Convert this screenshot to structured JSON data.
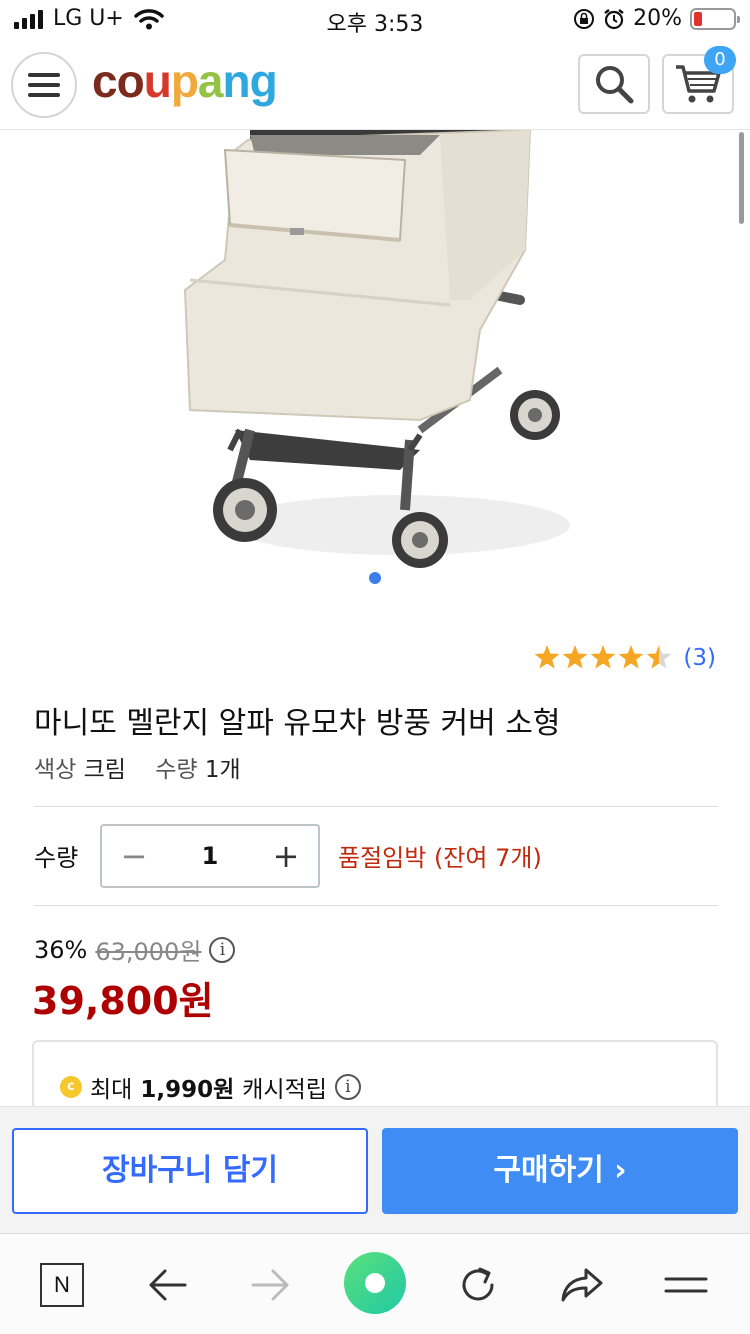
{
  "status_bar": {
    "carrier": "LG U+",
    "time": "오후 3:53",
    "battery_percent": "20%",
    "battery_level": 0.2,
    "icons": [
      "signal-icon",
      "wifi-icon",
      "rotation-lock-icon",
      "alarm-icon",
      "battery-icon"
    ]
  },
  "header": {
    "logo_letters": [
      "c",
      "o",
      "u",
      "p",
      "a",
      "n",
      "g"
    ],
    "logo_colors": [
      "#7b2b1d",
      "#7b2b1d",
      "#d6382c",
      "#f2a93b",
      "#94c245",
      "#2ea8de",
      "#2ea8de"
    ],
    "cart_count": "0"
  },
  "gallery": {
    "dots": 1,
    "active_index": 0
  },
  "rating": {
    "stars": 4.5,
    "count": "(3)"
  },
  "product": {
    "title": "마니또 멜란지 알파 유모차 방풍 커버 소형",
    "option_color_label": "색상",
    "option_color_value": "크림",
    "option_qty_label": "수량",
    "option_qty_value": "1개"
  },
  "quantity": {
    "label": "수량",
    "minus": "−",
    "value": "1",
    "plus": "+",
    "stock_notice": "품절임박 (잔여 7개)"
  },
  "price": {
    "discount_rate": "36%",
    "original": "63,000원",
    "final": "39,800원",
    "info_glyph": "i"
  },
  "cash": {
    "coin_glyph": "c",
    "prefix": "최대",
    "amount": "1,990원",
    "suffix": "캐시적립",
    "info_glyph": "i"
  },
  "buttons": {
    "add_to_cart": "장바구니 담기",
    "buy_now": "구매하기 ›"
  },
  "browser_toolbar": {
    "n_label": "N",
    "items": [
      "n-tab-icon",
      "back-arrow-icon",
      "forward-arrow-icon",
      "green-dot-icon",
      "reload-icon",
      "share-icon",
      "menu-icon"
    ]
  },
  "colors": {
    "brand_blue": "#346aff",
    "price_red": "#ae0000",
    "stock_red": "#c2290f",
    "star_orange": "#f5a623",
    "buy_blue": "#3f8cf5"
  }
}
